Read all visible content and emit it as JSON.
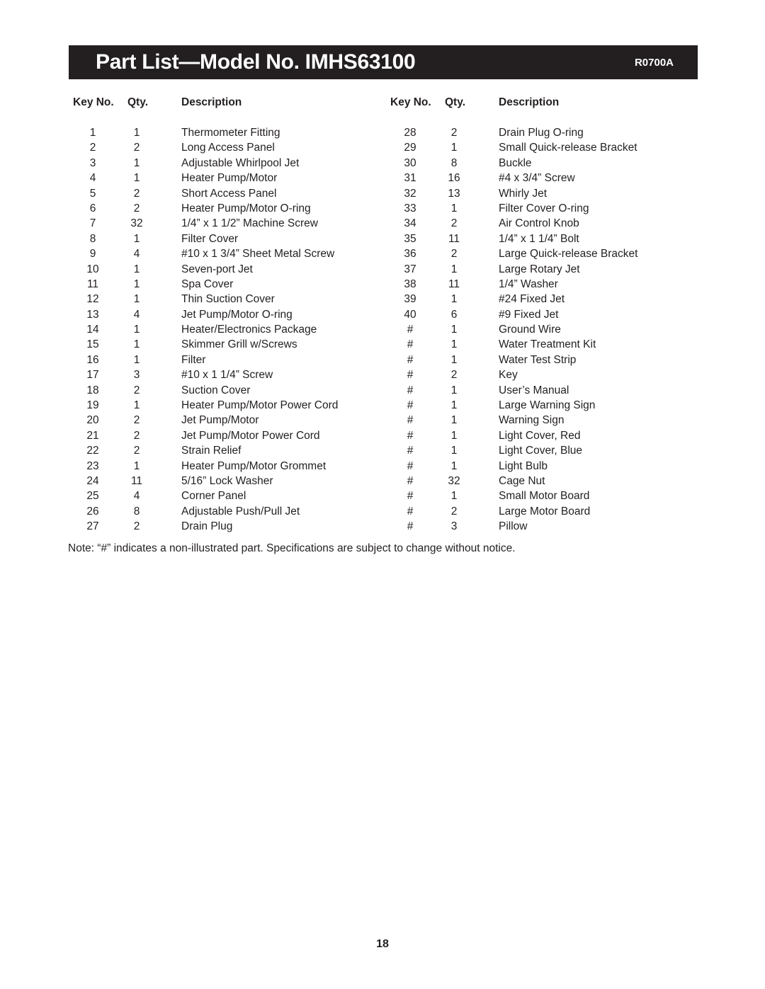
{
  "header": {
    "title": "Part List—Model No. IMHS63100",
    "code": "R0700A"
  },
  "columns": {
    "headers": {
      "key_no": "Key No.",
      "qty": "Qty.",
      "description": "Description"
    }
  },
  "left_rows": [
    {
      "key": "1",
      "qty": "1",
      "desc": "Thermometer Fitting"
    },
    {
      "key": "2",
      "qty": "2",
      "desc": "Long Access Panel"
    },
    {
      "key": "3",
      "qty": "1",
      "desc": "Adjustable Whirlpool Jet"
    },
    {
      "key": "4",
      "qty": "1",
      "desc": "Heater Pump/Motor"
    },
    {
      "key": "5",
      "qty": "2",
      "desc": "Short Access Panel"
    },
    {
      "key": "6",
      "qty": "2",
      "desc": "Heater Pump/Motor O-ring"
    },
    {
      "key": "7",
      "qty": "32",
      "desc": "1/4” x 1 1/2” Machine Screw"
    },
    {
      "key": "8",
      "qty": "1",
      "desc": "Filter Cover"
    },
    {
      "key": "9",
      "qty": "4",
      "desc": "#10 x 1 3/4” Sheet Metal Screw"
    },
    {
      "key": "10",
      "qty": "1",
      "desc": "Seven-port Jet"
    },
    {
      "key": "11",
      "qty": "1",
      "desc": "Spa Cover"
    },
    {
      "key": "12",
      "qty": "1",
      "desc": "Thin Suction Cover"
    },
    {
      "key": "13",
      "qty": "4",
      "desc": "Jet Pump/Motor O-ring"
    },
    {
      "key": "14",
      "qty": "1",
      "desc": "Heater/Electronics Package"
    },
    {
      "key": "15",
      "qty": "1",
      "desc": "Skimmer Grill w/Screws"
    },
    {
      "key": "16",
      "qty": "1",
      "desc": "Filter"
    },
    {
      "key": "17",
      "qty": "3",
      "desc": "#10 x 1 1/4” Screw"
    },
    {
      "key": "18",
      "qty": "2",
      "desc": "Suction Cover"
    },
    {
      "key": "19",
      "qty": "1",
      "desc": "Heater Pump/Motor Power Cord"
    },
    {
      "key": "20",
      "qty": "2",
      "desc": "Jet Pump/Motor"
    },
    {
      "key": "21",
      "qty": "2",
      "desc": "Jet Pump/Motor Power Cord"
    },
    {
      "key": "22",
      "qty": "2",
      "desc": "Strain Relief"
    },
    {
      "key": "23",
      "qty": "1",
      "desc": "Heater Pump/Motor Grommet"
    },
    {
      "key": "24",
      "qty": "11",
      "desc": "5/16” Lock Washer"
    },
    {
      "key": "25",
      "qty": "4",
      "desc": "Corner Panel"
    },
    {
      "key": "26",
      "qty": "8",
      "desc": "Adjustable Push/Pull Jet"
    },
    {
      "key": "27",
      "qty": "2",
      "desc": "Drain Plug"
    }
  ],
  "right_rows": [
    {
      "key": "28",
      "qty": "2",
      "desc": "Drain Plug O-ring"
    },
    {
      "key": "29",
      "qty": "1",
      "desc": "Small Quick-release Bracket"
    },
    {
      "key": "30",
      "qty": "8",
      "desc": "Buckle"
    },
    {
      "key": "31",
      "qty": "16",
      "desc": "#4 x 3/4” Screw"
    },
    {
      "key": "32",
      "qty": "13",
      "desc": "Whirly Jet"
    },
    {
      "key": "33",
      "qty": "1",
      "desc": "Filter Cover O-ring"
    },
    {
      "key": "34",
      "qty": "2",
      "desc": "Air Control Knob"
    },
    {
      "key": "35",
      "qty": "11",
      "desc": "1/4” x 1 1/4” Bolt"
    },
    {
      "key": "36",
      "qty": "2",
      "desc": "Large Quick-release Bracket"
    },
    {
      "key": "37",
      "qty": "1",
      "desc": "Large Rotary Jet"
    },
    {
      "key": "38",
      "qty": "11",
      "desc": "1/4” Washer"
    },
    {
      "key": "39",
      "qty": "1",
      "desc": "#24 Fixed Jet"
    },
    {
      "key": "40",
      "qty": "6",
      "desc": "#9 Fixed Jet"
    },
    {
      "key": "#",
      "qty": "1",
      "desc": "Ground Wire"
    },
    {
      "key": "#",
      "qty": "1",
      "desc": "Water Treatment Kit"
    },
    {
      "key": "#",
      "qty": "1",
      "desc": "Water Test Strip"
    },
    {
      "key": "#",
      "qty": "2",
      "desc": "Key"
    },
    {
      "key": "#",
      "qty": "1",
      "desc": "User’s Manual"
    },
    {
      "key": "#",
      "qty": "1",
      "desc": "Large Warning Sign"
    },
    {
      "key": "#",
      "qty": "1",
      "desc": "Warning Sign"
    },
    {
      "key": "#",
      "qty": "1",
      "desc": "Light Cover, Red"
    },
    {
      "key": "#",
      "qty": "1",
      "desc": "Light Cover, Blue"
    },
    {
      "key": "#",
      "qty": "1",
      "desc": "Light Bulb"
    },
    {
      "key": "#",
      "qty": "32",
      "desc": "Cage Nut"
    },
    {
      "key": "#",
      "qty": "1",
      "desc": "Small Motor Board"
    },
    {
      "key": "#",
      "qty": "2",
      "desc": "Large Motor Board"
    },
    {
      "key": "#",
      "qty": "3",
      "desc": "Pillow"
    }
  ],
  "note": "Note: “#” indicates a non-illustrated part. Specifications are subject to change without notice.",
  "page_number": "18",
  "colors": {
    "header_bar": "#231f20",
    "header_text": "#ffffff",
    "body_text": "#231f20",
    "background": "#ffffff"
  }
}
